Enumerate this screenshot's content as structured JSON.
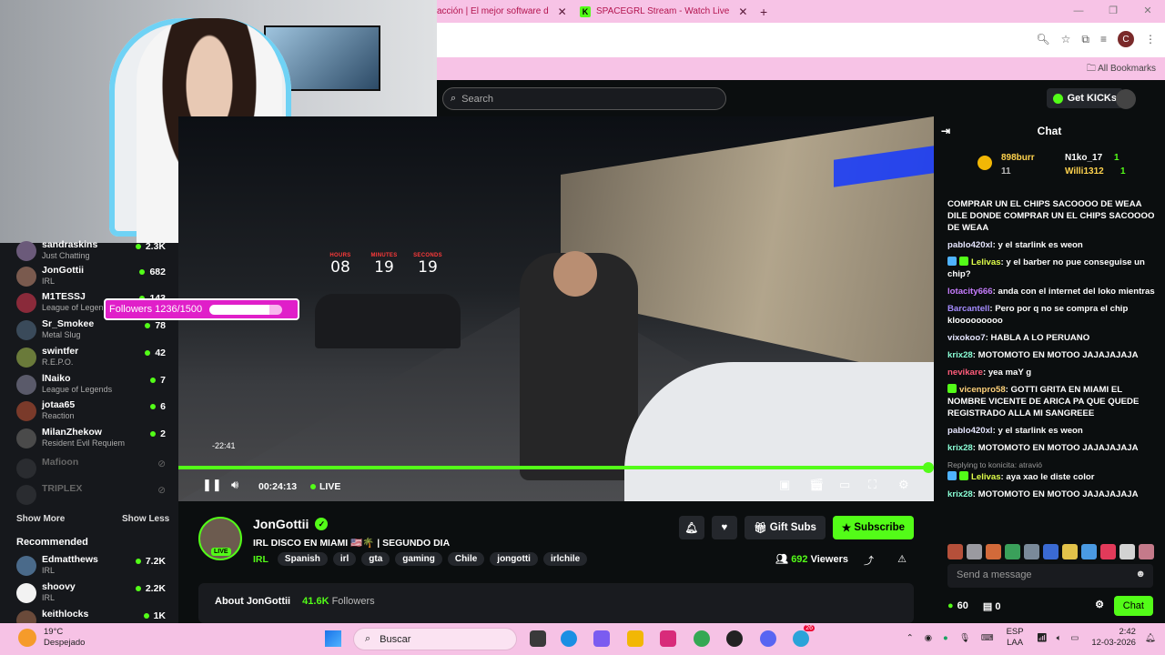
{
  "browser": {
    "tabs": [
      {
        "title": "acción | El mejor software d"
      },
      {
        "title": "SPACEGRL Stream - Watch Live",
        "favicon": "K"
      }
    ],
    "new_tab": "+",
    "bookmarks_label": "All Bookmarks",
    "profile_initial": "C"
  },
  "kick": {
    "search_placeholder": "Search",
    "get_kicks": "Get KICKs"
  },
  "sidebar": {
    "channels": [
      {
        "name": "sandraskins",
        "category": "Just Chatting",
        "viewers": "2.3K",
        "online": true
      },
      {
        "name": "JonGottii",
        "category": "IRL",
        "viewers": "682",
        "online": true
      },
      {
        "name": "M1TESSJ",
        "category": "League of Legends",
        "viewers": "143",
        "online": true
      },
      {
        "name": "Sr_Smokee",
        "category": "Metal Slug",
        "viewers": "78",
        "online": true
      },
      {
        "name": "swintfer",
        "category": "R.E.P.O.",
        "viewers": "42",
        "online": true
      },
      {
        "name": "lNaiko",
        "category": "League of Legends",
        "viewers": "7",
        "online": true
      },
      {
        "name": "jotaa65",
        "category": "Reaction",
        "viewers": "6",
        "online": true
      },
      {
        "name": "MilanZhekow",
        "category": "Resident Evil Requiem",
        "viewers": "2",
        "online": true
      },
      {
        "name": "Mafioon",
        "category": "",
        "viewers": "",
        "online": false
      },
      {
        "name": "TRIPLEX",
        "category": "",
        "viewers": "",
        "online": false
      }
    ],
    "show_more": "Show More",
    "show_less": "Show Less",
    "recommended_title": "Recommended",
    "recommended": [
      {
        "name": "Edmatthews",
        "category": "IRL",
        "viewers": "7.2K"
      },
      {
        "name": "shoovy",
        "category": "IRL",
        "viewers": "2.2K"
      },
      {
        "name": "keithlocks",
        "category": "",
        "viewers": "1K"
      }
    ]
  },
  "overlay": {
    "timer": [
      {
        "label": "HOURS",
        "value": "08"
      },
      {
        "label": "MINUTES",
        "value": "19"
      },
      {
        "label": "SECONDS",
        "value": "19"
      }
    ],
    "followers_goal": "Followers 1236/1500",
    "followers_progress": 0.824
  },
  "player": {
    "scrub_time": "-22:41",
    "elapsed": "00:24:13",
    "live_label": "LIVE",
    "progress": 1.0
  },
  "stream": {
    "channel_name": "JonGottii",
    "live_badge": "LIVE",
    "title": "IRL DISCO EN MIAMI 🇺🇸🌴 | SEGUNDO DIA",
    "category": "IRL",
    "tags": [
      "Spanish",
      "irl",
      "gta",
      "gaming",
      "Chile",
      "jongotti",
      "irlchile"
    ],
    "gift_subs": "Gift Subs",
    "subscribe": "Subscribe",
    "viewer_count": "692",
    "viewers_label": "Viewers",
    "about_label": "About JonGottii",
    "followers_count": "41.6K",
    "followers_label": "Followers"
  },
  "chat": {
    "header": "Chat",
    "gifters": [
      {
        "name": "898burr",
        "count": "11"
      },
      {
        "name": "N1ko_17",
        "count": "1"
      },
      {
        "name": "Willi1312",
        "count": "1"
      }
    ],
    "messages": [
      {
        "user": "",
        "text": "COMPRAR UN EL CHIPS SACOOOO DE WEAA DILE DONDE COMPRAR UN EL CHIPS SACOOOO DE WEAA",
        "color": "#ffffff"
      },
      {
        "user": "pablo420xl",
        "text": "y el starlink es weon",
        "color": "#e6e6ff"
      },
      {
        "user": "Lelivas",
        "text": "y el barber no pue conseguise un chip?",
        "color": "#e0ff4a",
        "badges": true
      },
      {
        "user": "lotacity666",
        "text": "anda con el internet del loko mientras",
        "color": "#c77dff"
      },
      {
        "user": "Barcantell",
        "text": "Pero por q no se compra el chip klooooooooo",
        "color": "#a58cff"
      },
      {
        "user": "vixokoo7",
        "text": "HABLA A LO PERUANO",
        "color": "#e6e6ff"
      },
      {
        "user": "krix28",
        "text": "MOTOMOTO EN MOTOO JAJAJAJAJA",
        "color": "#8affd6"
      },
      {
        "user": "nevikare",
        "text": "yea maY g",
        "color": "#ff5c7a"
      },
      {
        "user": "vicenpro58",
        "text": "GOTTI GRITA EN MIAMI EL NOMBRE VICENTE DE ARICA PA QUE QUEDE REGISTRADO ALLA MI SANGREEE",
        "color": "#ffd27a",
        "gift": true
      },
      {
        "user": "pablo420xl",
        "text": "y el starlink es weon",
        "color": "#e6e6ff"
      },
      {
        "user": "krix28",
        "text": "MOTOMOTO EN MOTOO JAJAJAJAJA",
        "color": "#8affd6"
      },
      {
        "user": "Lelivas",
        "text": "aya xao le diste color",
        "color": "#e0ff4a",
        "badges": true,
        "reply": "Replying to konicita: atravió"
      },
      {
        "user": "krix28",
        "text": "MOTOMOTO EN MOTOO JAJAJAJAJA",
        "color": "#8affd6"
      }
    ],
    "send_placeholder": "Send a message",
    "points": "60",
    "drops": "0",
    "chat_button": "Chat"
  },
  "taskbar": {
    "temperature": "19°C",
    "weather": "Despejado",
    "search": "Buscar",
    "lang_top": "ESP",
    "lang_bottom": "LAA",
    "time": "2:42",
    "date": "12-03-2026",
    "badge": "26"
  }
}
